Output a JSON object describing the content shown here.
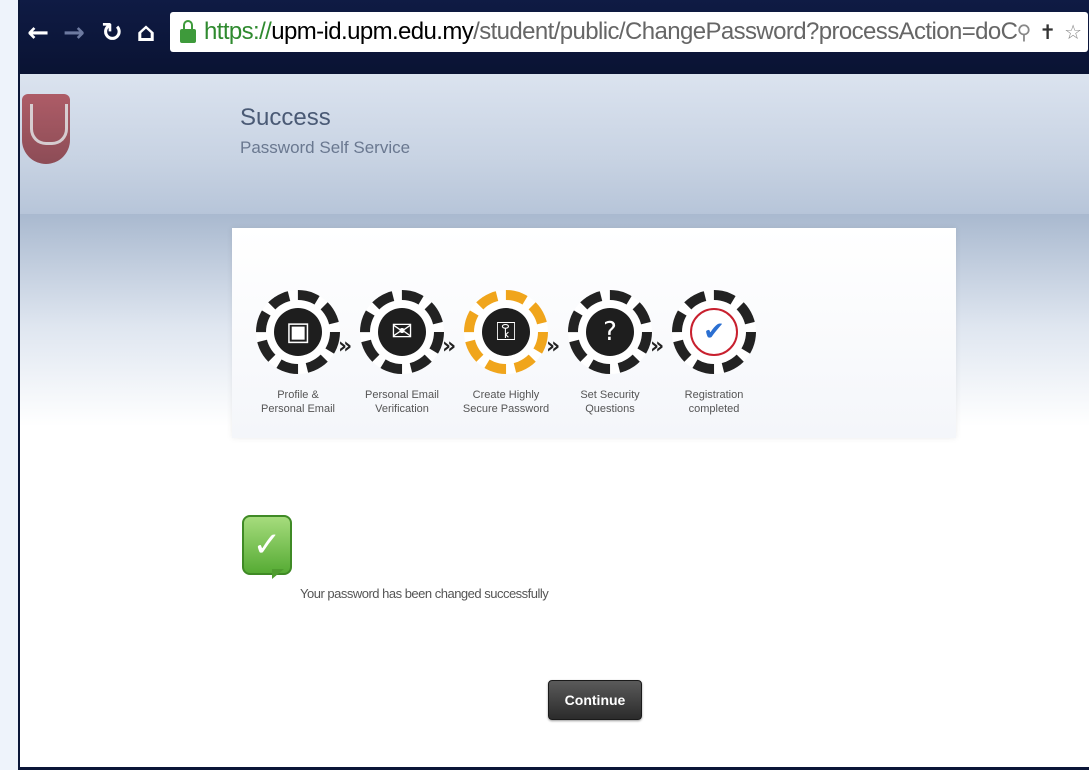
{
  "browser": {
    "url_protocol": "https://",
    "url_host": "upm-id.upm.edu.my",
    "url_path": "/student/public/ChangePassword?processAction=doChan",
    "back_icon": "arrow-left",
    "forward_icon": "arrow-right",
    "reload_icon": "reload",
    "home_icon": "home",
    "lock_icon": "lock",
    "search_icon": "magnifier",
    "extension_icon": "pin",
    "bookmark_icon": "star"
  },
  "header": {
    "title": "Success",
    "subtitle": "Password Self Service"
  },
  "steps": [
    {
      "label_line1": "Profile &",
      "label_line2": "Personal Email",
      "icon": "id-card",
      "active": false
    },
    {
      "label_line1": "Personal Email",
      "label_line2": "Verification",
      "icon": "envelope",
      "active": false
    },
    {
      "label_line1": "Create Highly",
      "label_line2": "Secure Password",
      "icon": "lock-shield",
      "active": true
    },
    {
      "label_line1": "Set Security",
      "label_line2": "Questions",
      "icon": "question-shield",
      "active": false
    },
    {
      "label_line1": "Registration",
      "label_line2": "completed",
      "icon": "checkmark-upm",
      "active": false
    }
  ],
  "message": {
    "text": "Your password has been changed successfully",
    "icon": "checkmark-speech-bubble"
  },
  "actions": {
    "continue_label": "Continue"
  },
  "colors": {
    "toolbar": "#0f1b44",
    "active_step": "#f0a51c",
    "success": "#56ab34"
  }
}
